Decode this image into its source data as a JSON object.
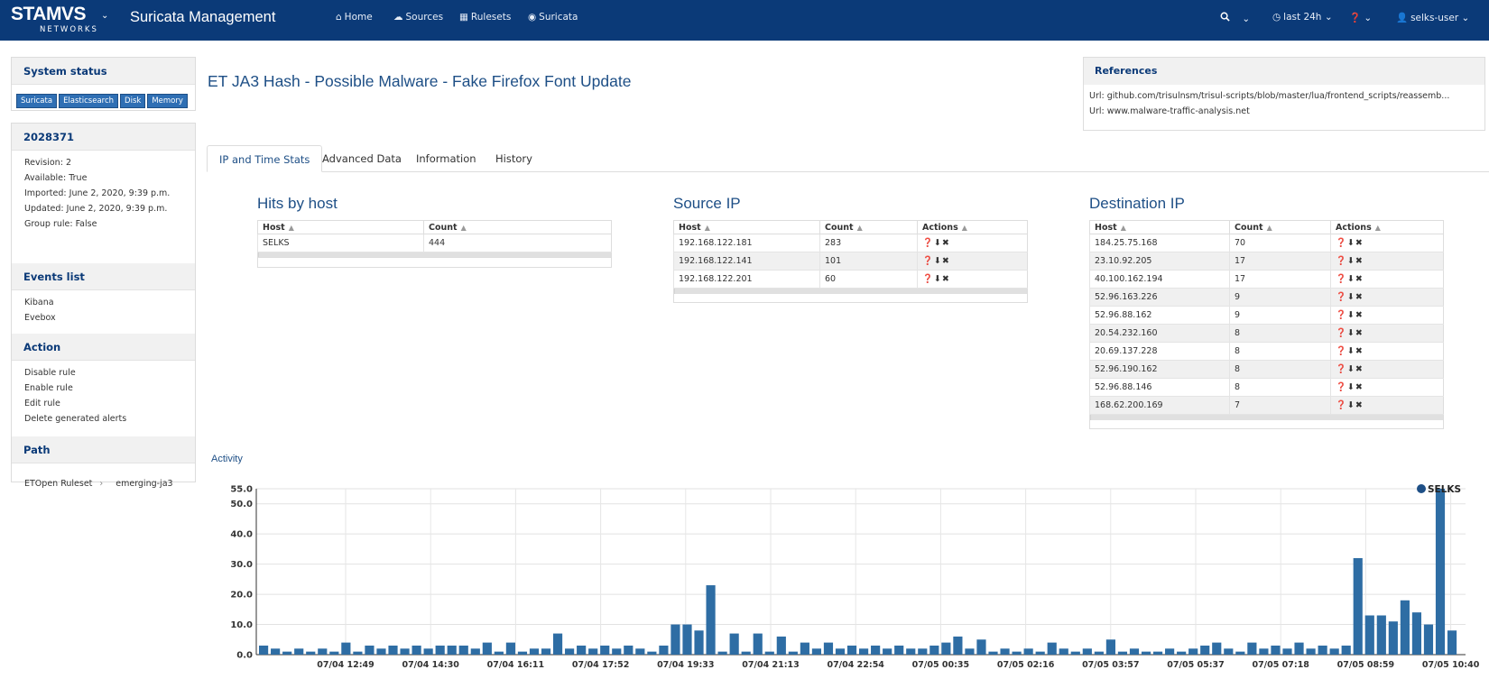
{
  "header": {
    "logo": "STAMVS",
    "logo_sub": "NETWORKS",
    "app_title": "Suricata Management",
    "nav": [
      {
        "label": "Home",
        "icon": "home-icon",
        "glyph": "⌂"
      },
      {
        "label": "Sources",
        "icon": "cloud-icon",
        "glyph": "☁"
      },
      {
        "label": "Rulesets",
        "icon": "grid-icon",
        "glyph": "▦"
      },
      {
        "label": "Suricata",
        "icon": "eye-icon",
        "glyph": "◉"
      }
    ],
    "search_icon": "search-icon",
    "time_range": "last 24h",
    "user": "selks-user"
  },
  "sidebar": {
    "status_title": "System status",
    "status_badges": [
      "Suricata",
      "Elasticsearch",
      "Disk",
      "Memory"
    ],
    "rule_id": "2028371",
    "rule_info": [
      {
        "k": "Revision:",
        "v": "2"
      },
      {
        "k": "Available:",
        "v": "True"
      },
      {
        "k": "Imported:",
        "v": "June 2, 2020, 9:39 p.m."
      },
      {
        "k": "Updated:",
        "v": "June 2, 2020, 9:39 p.m."
      },
      {
        "k": "Group rule:",
        "v": "False"
      }
    ],
    "events_title": "Events list",
    "events": [
      "Kibana",
      "Evebox"
    ],
    "action_title": "Action",
    "actions": [
      "Disable rule",
      "Enable rule",
      "Edit rule",
      "Delete generated alerts"
    ],
    "path_title": "Path",
    "path": [
      "ETOpen Ruleset",
      "emerging-ja3"
    ]
  },
  "page_title": "ET JA3 Hash - Possible Malware - Fake Firefox Font Update",
  "references": {
    "title": "References",
    "items": [
      {
        "k": "Url:",
        "v": "github.com/trisulnsm/trisul-scripts/blob/master/lua/frontend_scripts/reassemb..."
      },
      {
        "k": "Url:",
        "v": "www.malware-traffic-analysis.net"
      }
    ]
  },
  "tabs": [
    "IP and Time Stats",
    "Advanced Data",
    "Information",
    "History"
  ],
  "hits_by_host": {
    "title": "Hits by host",
    "columns": [
      "Host",
      "Count"
    ],
    "rows": [
      [
        "SELKS",
        "444"
      ]
    ]
  },
  "source_ip": {
    "title": "Source IP",
    "columns": [
      "Host",
      "Count",
      "Actions"
    ],
    "rows": [
      [
        "192.168.122.181",
        "283"
      ],
      [
        "192.168.122.141",
        "101"
      ],
      [
        "192.168.122.201",
        "60"
      ]
    ]
  },
  "destination_ip": {
    "title": "Destination IP",
    "columns": [
      "Host",
      "Count",
      "Actions"
    ],
    "rows": [
      [
        "184.25.75.168",
        "70"
      ],
      [
        "23.10.92.205",
        "17"
      ],
      [
        "40.100.162.194",
        "17"
      ],
      [
        "52.96.163.226",
        "9"
      ],
      [
        "52.96.88.162",
        "9"
      ],
      [
        "20.54.232.160",
        "8"
      ],
      [
        "20.69.137.228",
        "8"
      ],
      [
        "52.96.190.162",
        "8"
      ],
      [
        "52.96.88.146",
        "8"
      ],
      [
        "168.62.200.169",
        "7"
      ]
    ]
  },
  "activity_title": "Activity",
  "colors": {
    "brand": "#0b3a78",
    "accent": "#1e4f86",
    "bar": "#2e6da4"
  },
  "chart_data": {
    "type": "bar",
    "series": [
      {
        "name": "SELKS",
        "values": [
          3,
          2,
          1,
          2,
          1,
          2,
          1,
          4,
          1,
          3,
          2,
          3,
          2,
          3,
          2,
          3,
          3,
          3,
          2,
          4,
          1,
          4,
          1,
          2,
          2,
          7,
          2,
          3,
          2,
          3,
          2,
          3,
          2,
          1,
          3,
          10,
          10,
          8,
          23,
          1,
          7,
          1,
          7,
          1,
          6,
          1,
          4,
          2,
          4,
          2,
          3,
          2,
          3,
          2,
          3,
          2,
          2,
          3,
          4,
          6,
          2,
          5,
          1,
          2,
          1,
          2,
          1,
          4,
          2,
          1,
          2,
          1,
          5,
          1,
          2,
          1,
          1,
          2,
          1,
          2,
          3,
          4,
          2,
          1,
          4,
          2,
          3,
          2,
          4,
          2,
          3,
          2,
          3,
          32,
          13,
          13,
          11,
          18,
          14,
          10,
          55,
          8
        ]
      }
    ],
    "x_ticks": [
      "07/04 12:49",
      "07/04 14:30",
      "07/04 16:11",
      "07/04 17:52",
      "07/04 19:33",
      "07/04 21:13",
      "07/04 22:54",
      "07/05 00:35",
      "07/05 02:16",
      "07/05 03:57",
      "07/05 05:37",
      "07/05 07:18",
      "07/05 08:59",
      "07/05 10:40"
    ],
    "y_ticks": [
      "0.0",
      "10.0",
      "20.0",
      "30.0",
      "40.0",
      "50.0",
      "55.0"
    ],
    "ylim": [
      0,
      55
    ],
    "legend": "top-right",
    "grid": true
  }
}
